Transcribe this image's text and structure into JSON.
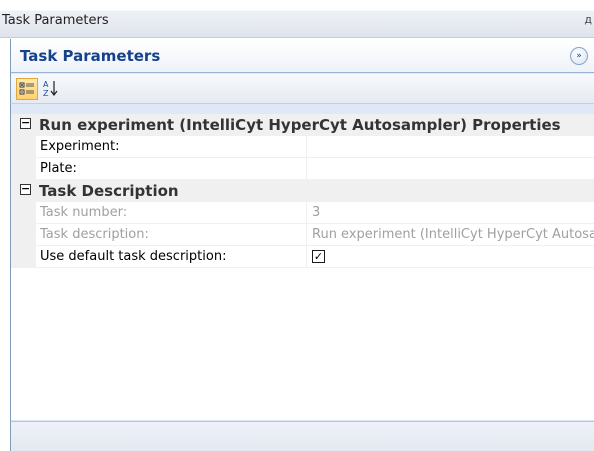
{
  "window": {
    "title": "Task Parameters",
    "pin_glyph": "д"
  },
  "panel": {
    "title": "Task Parameters",
    "expand_glyph": "»"
  },
  "toolbar": {
    "categorized_icon": "categorized-view-icon",
    "alphabetical_icon": "sort-alphabetical-icon"
  },
  "grid": {
    "categories": [
      {
        "label": "Run experiment (IntelliCyt HyperCyt Autosampler) Properties",
        "toggle": "−",
        "properties": [
          {
            "name": "Experiment:",
            "value": ""
          },
          {
            "name": "Plate:",
            "value": ""
          }
        ]
      },
      {
        "label": "Task Description",
        "toggle": "−",
        "properties": [
          {
            "name": "Task number:",
            "value": "3"
          },
          {
            "name": "Task description:",
            "value": "Run experiment (IntelliCyt HyperCyt Autosampler)"
          },
          {
            "name": "Use default task description:",
            "checked": true,
            "check_glyph": "✓"
          }
        ]
      }
    ]
  },
  "colors": {
    "header_text": "#15428b",
    "readonly_text": "#a0a0a0",
    "category_bg": "#f0f0f0",
    "frame_border": "#7f9db9"
  }
}
